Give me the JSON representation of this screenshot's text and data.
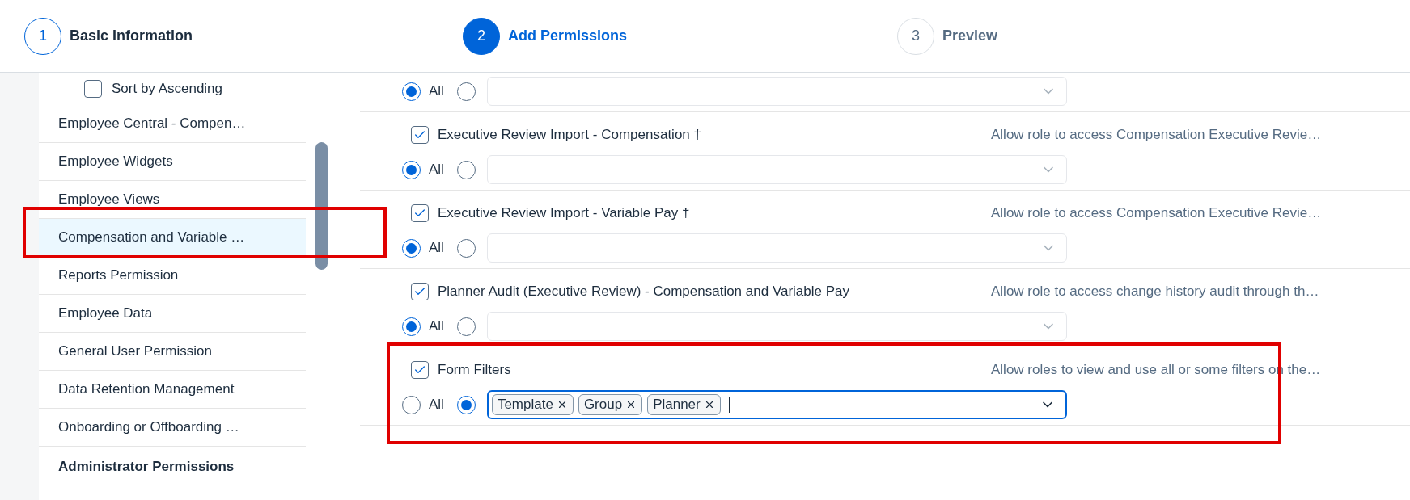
{
  "stepper": [
    {
      "number": "1",
      "label": "Basic Information",
      "selected": false,
      "completed": true
    },
    {
      "number": "2",
      "label": "Add Permissions",
      "selected": true,
      "completed": false
    },
    {
      "number": "3",
      "label": "Preview",
      "selected": false,
      "completed": false
    }
  ],
  "sidebar": {
    "sort": {
      "label": "Sort by Ascending",
      "checked": false
    },
    "items": [
      {
        "label": "Employee Central - Compen…",
        "selected": false,
        "highlighted": false
      },
      {
        "label": "Employee Widgets",
        "selected": false,
        "highlighted": false
      },
      {
        "label": "Employee Views",
        "selected": false,
        "highlighted": false
      },
      {
        "label": "Compensation and Variable …",
        "selected": true,
        "highlighted": true
      },
      {
        "label": "Reports Permission",
        "selected": false,
        "highlighted": false
      },
      {
        "label": "Employee Data",
        "selected": false,
        "highlighted": false
      },
      {
        "label": "General User Permission",
        "selected": false,
        "highlighted": false
      },
      {
        "label": "Data Retention Management",
        "selected": false,
        "highlighted": false
      },
      {
        "label": "Onboarding or Offboarding …",
        "selected": false,
        "highlighted": false
      }
    ],
    "section_heading": "Administrator Permissions"
  },
  "permissions": [
    {
      "options": [
        {
          "label": "All",
          "selected": true
        },
        {
          "selected": false
        }
      ],
      "highlighted": false,
      "field": {
        "focused": false
      }
    },
    {
      "title": "Executive Review Import - Compensation †",
      "description": "Allow role to access Compensation Executive Revie…",
      "checked": true,
      "highlighted": false,
      "options": [
        {
          "label": "All",
          "selected": true
        },
        {
          "selected": false
        }
      ],
      "field": {
        "focused": false
      }
    },
    {
      "title": "Executive Review Import - Variable Pay †",
      "description": "Allow role to access Compensation Executive Revie…",
      "checked": true,
      "highlighted": false,
      "options": [
        {
          "label": "All",
          "selected": true
        },
        {
          "selected": false
        }
      ],
      "field": {
        "focused": false
      }
    },
    {
      "title": "Planner Audit (Executive Review) - Compensation and Variable Pay",
      "description": "Allow role to access change history audit through th…",
      "checked": true,
      "highlighted": false,
      "options": [
        {
          "label": "All",
          "selected": true
        },
        {
          "selected": false
        }
      ],
      "field": {
        "focused": false
      }
    },
    {
      "title": "Form Filters",
      "description": "Allow roles to view and use all or some filters on the…",
      "checked": true,
      "highlighted": true,
      "options": [
        {
          "label": "All",
          "selected": false
        },
        {
          "selected": true
        }
      ],
      "field": {
        "focused": true,
        "tokens": [
          "Template",
          "Group",
          "Planner"
        ]
      }
    }
  ]
}
